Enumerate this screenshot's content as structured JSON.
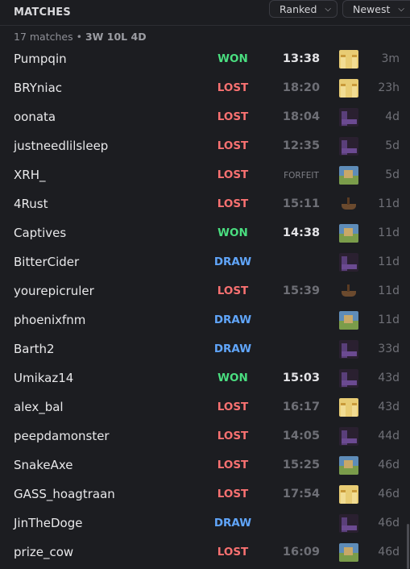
{
  "header": {
    "title": "MATCHES",
    "ranked_label": "Ranked",
    "newest_label": "Newest"
  },
  "summary": {
    "count_text": "17 matches",
    "separator": " • ",
    "record": "3W 10L 4D"
  },
  "matches": [
    {
      "name": "Pumpqin",
      "result": "WON",
      "time": "13:38",
      "time_style": "highlight",
      "icon": "desert-temple-icon",
      "age": "3m"
    },
    {
      "name": "BRYniac",
      "result": "LOST",
      "time": "18:20",
      "time_style": "dim",
      "icon": "desert-temple-icon",
      "age": "23h"
    },
    {
      "name": "oonata",
      "result": "LOST",
      "time": "18:04",
      "time_style": "dim",
      "icon": "bastion-icon",
      "age": "4d"
    },
    {
      "name": "justneedlilsleep",
      "result": "LOST",
      "time": "12:35",
      "time_style": "dim",
      "icon": "bastion-icon",
      "age": "5d"
    },
    {
      "name": "XRH_",
      "result": "LOST",
      "time": "FORFEIT",
      "time_style": "forfeit",
      "icon": "village-icon",
      "age": "5d"
    },
    {
      "name": "4Rust",
      "result": "LOST",
      "time": "15:11",
      "time_style": "dim",
      "icon": "shipwreck-icon",
      "age": "11d"
    },
    {
      "name": "Captives",
      "result": "WON",
      "time": "14:38",
      "time_style": "highlight",
      "icon": "village-icon",
      "age": "11d"
    },
    {
      "name": "BitterCider",
      "result": "DRAW",
      "time": "",
      "time_style": "dim",
      "icon": "bastion-icon",
      "age": "11d"
    },
    {
      "name": "yourepicruler",
      "result": "LOST",
      "time": "15:39",
      "time_style": "dim",
      "icon": "shipwreck-icon",
      "age": "11d"
    },
    {
      "name": "phoenixfnm",
      "result": "DRAW",
      "time": "",
      "time_style": "dim",
      "icon": "village-icon",
      "age": "11d"
    },
    {
      "name": "Barth2",
      "result": "DRAW",
      "time": "",
      "time_style": "dim",
      "icon": "bastion-icon",
      "age": "33d"
    },
    {
      "name": "Umikaz14",
      "result": "WON",
      "time": "15:03",
      "time_style": "highlight",
      "icon": "bastion-icon",
      "age": "43d"
    },
    {
      "name": "alex_bal",
      "result": "LOST",
      "time": "16:17",
      "time_style": "dim",
      "icon": "desert-temple-icon",
      "age": "43d"
    },
    {
      "name": "peepdamonster",
      "result": "LOST",
      "time": "14:05",
      "time_style": "dim",
      "icon": "bastion-icon",
      "age": "44d"
    },
    {
      "name": "SnakeAxe",
      "result": "LOST",
      "time": "15:25",
      "time_style": "dim",
      "icon": "village-icon",
      "age": "46d"
    },
    {
      "name": "GASS_hoagtraan",
      "result": "LOST",
      "time": "17:54",
      "time_style": "dim",
      "icon": "desert-temple-icon",
      "age": "46d"
    },
    {
      "name": "JinTheDoge",
      "result": "DRAW",
      "time": "",
      "time_style": "dim",
      "icon": "bastion-icon",
      "age": "46d"
    },
    {
      "name": "prize_cow",
      "result": "LOST",
      "time": "16:09",
      "time_style": "dim",
      "icon": "village-icon",
      "age": "46d"
    }
  ],
  "colors": {
    "won": "#4ade80",
    "lost": "#f87171",
    "draw": "#60a5fa",
    "background": "#1c1d21"
  }
}
